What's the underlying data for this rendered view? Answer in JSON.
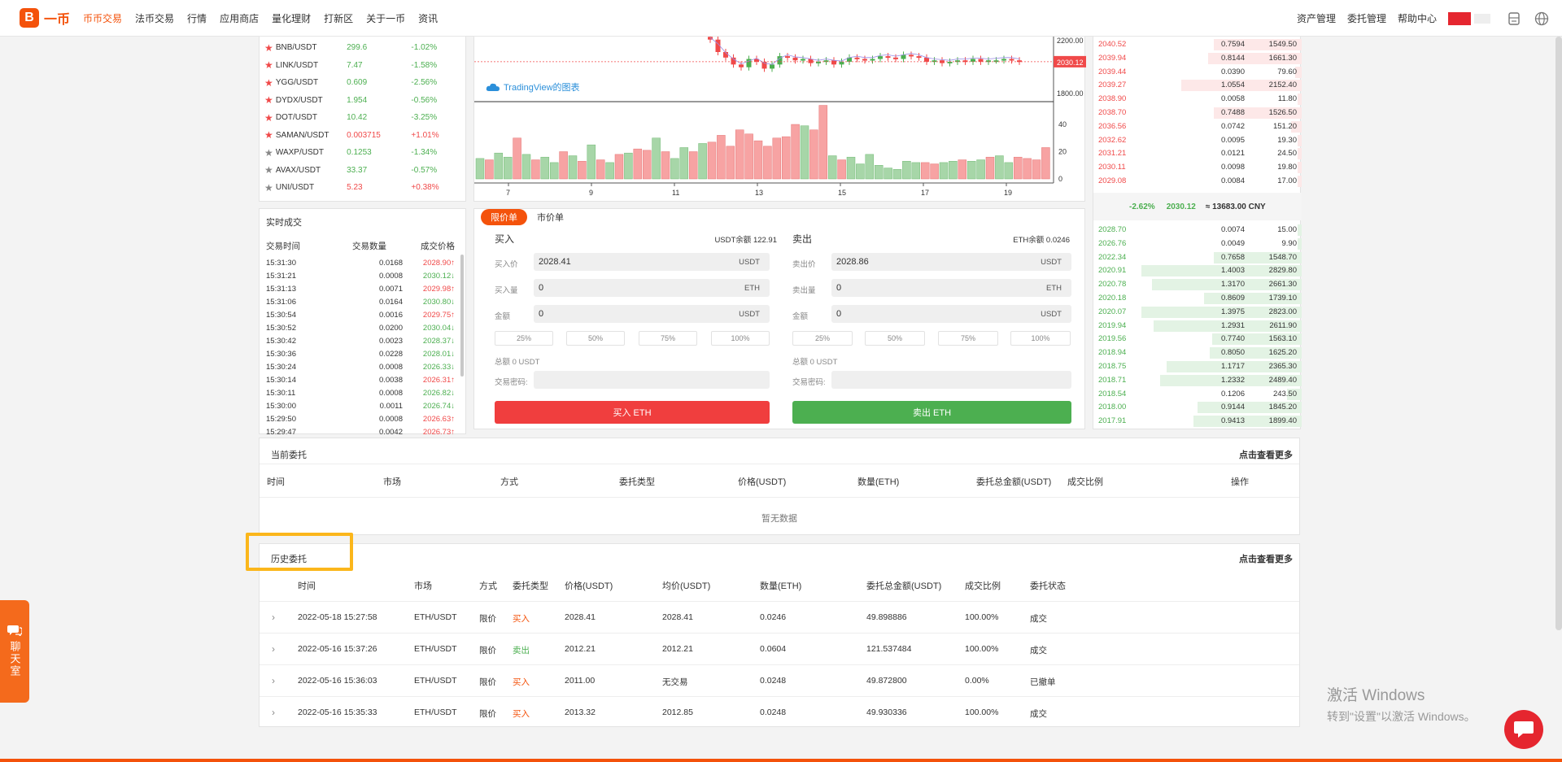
{
  "nav": {
    "logo_text": "一币",
    "items": [
      "币币交易",
      "法币交易",
      "行情",
      "应用商店",
      "量化理财",
      "打新区",
      "关于一币",
      "资讯"
    ],
    "active_index": 0,
    "right_items": [
      "资产管理",
      "委托管理",
      "帮助中心"
    ],
    "accent_color": "#f4520b"
  },
  "markets": [
    {
      "name": "BNB/USDT",
      "price": "299.6",
      "change": "-1.02%",
      "dir": "green",
      "starred": true
    },
    {
      "name": "LINK/USDT",
      "price": "7.47",
      "change": "-1.58%",
      "dir": "green",
      "starred": true
    },
    {
      "name": "YGG/USDT",
      "price": "0.609",
      "change": "-2.56%",
      "dir": "green",
      "starred": true
    },
    {
      "name": "DYDX/USDT",
      "price": "1.954",
      "change": "-0.56%",
      "dir": "green",
      "starred": true
    },
    {
      "name": "DOT/USDT",
      "price": "10.42",
      "change": "-3.25%",
      "dir": "green",
      "starred": true
    },
    {
      "name": "SAMAN/USDT",
      "price": "0.003715",
      "change": "+1.01%",
      "dir": "red",
      "starred": true
    },
    {
      "name": "WAXP/USDT",
      "price": "0.1253",
      "change": "-1.34%",
      "dir": "green",
      "starred": false
    },
    {
      "name": "AVAX/USDT",
      "price": "33.37",
      "change": "-0.57%",
      "dir": "green",
      "starred": false
    },
    {
      "name": "UNI/USDT",
      "price": "5.23",
      "change": "+0.38%",
      "dir": "red",
      "starred": false
    }
  ],
  "trades": {
    "title": "实时成交",
    "headers": [
      "交易时间",
      "交易数量",
      "成交价格"
    ],
    "rows": [
      {
        "time": "15:31:30",
        "qty": "0.0168",
        "price": "2028.90",
        "dir": "red",
        "arrow": "↑"
      },
      {
        "time": "15:31:21",
        "qty": "0.0008",
        "price": "2030.12",
        "dir": "green",
        "arrow": "↓"
      },
      {
        "time": "15:31:13",
        "qty": "0.0071",
        "price": "2029.98",
        "dir": "red",
        "arrow": "↑"
      },
      {
        "time": "15:31:06",
        "qty": "0.0164",
        "price": "2030.80",
        "dir": "green",
        "arrow": "↓"
      },
      {
        "time": "15:30:54",
        "qty": "0.0016",
        "price": "2029.75",
        "dir": "red",
        "arrow": "↑"
      },
      {
        "time": "15:30:52",
        "qty": "0.0200",
        "price": "2030.04",
        "dir": "green",
        "arrow": "↓"
      },
      {
        "time": "15:30:42",
        "qty": "0.0023",
        "price": "2028.37",
        "dir": "green",
        "arrow": "↓"
      },
      {
        "time": "15:30:36",
        "qty": "0.0228",
        "price": "2028.01",
        "dir": "green",
        "arrow": "↓"
      },
      {
        "time": "15:30:24",
        "qty": "0.0008",
        "price": "2026.33",
        "dir": "green",
        "arrow": "↓"
      },
      {
        "time": "15:30:14",
        "qty": "0.0038",
        "price": "2026.31",
        "dir": "red",
        "arrow": "↑"
      },
      {
        "time": "15:30:11",
        "qty": "0.0008",
        "price": "2026.82",
        "dir": "green",
        "arrow": "↓"
      },
      {
        "time": "15:30:00",
        "qty": "0.0011",
        "price": "2026.74",
        "dir": "green",
        "arrow": "↓"
      },
      {
        "time": "15:29:50",
        "qty": "0.0008",
        "price": "2026.63",
        "dir": "red",
        "arrow": "↑"
      },
      {
        "time": "15:29:47",
        "qty": "0.0042",
        "price": "2026.73",
        "dir": "red",
        "arrow": "↑"
      }
    ]
  },
  "chart": {
    "watermark": "TradingView的图表",
    "price_ticks": [
      "2200.00",
      "1800.00"
    ],
    "current_price": "2030.12",
    "volume_ticks": [
      "40",
      "20",
      "0"
    ],
    "x_ticks": [
      "7",
      "9",
      "11",
      "13",
      "15",
      "17",
      "19"
    ],
    "volumes_up": [
      true,
      false,
      true,
      true,
      false,
      true,
      false,
      true,
      true,
      false,
      true,
      false,
      true,
      false,
      true,
      false,
      true,
      false,
      false,
      true,
      false,
      true,
      true,
      false,
      true,
      false,
      false,
      false,
      false,
      false,
      false,
      false,
      false,
      false,
      false,
      true,
      false,
      false,
      true,
      false,
      true,
      true,
      true,
      true,
      true,
      true,
      true,
      true,
      false,
      false,
      true,
      true,
      false,
      true,
      true,
      false,
      true,
      true,
      false,
      false,
      false,
      false
    ],
    "volumes": [
      15,
      14,
      19,
      16,
      30,
      18,
      14,
      16,
      12,
      20,
      17,
      13,
      25,
      14,
      12,
      18,
      19,
      22,
      21,
      30,
      20,
      15,
      23,
      20,
      26,
      27,
      32,
      24,
      36,
      33,
      28,
      24,
      30,
      31,
      40,
      39,
      36,
      54,
      17,
      14,
      16,
      11,
      18,
      10,
      8,
      7,
      13,
      12,
      12,
      11,
      12,
      13,
      14,
      13,
      14,
      16,
      17,
      12,
      16,
      15,
      14,
      23
    ],
    "closes": [
      2190,
      2100,
      2060,
      2010,
      1990,
      2050,
      2030,
      1980,
      2010,
      2070,
      2060,
      2040,
      2050,
      2020,
      2030,
      2040,
      2010,
      2030,
      2060,
      2050,
      2040,
      2050,
      2070,
      2060,
      2050,
      2080,
      2070,
      2060,
      2030,
      2040,
      2020,
      2030,
      2040,
      2030,
      2050,
      2030,
      2040,
      2040,
      2050,
      2040,
      2030
    ]
  },
  "orderform": {
    "tabs": [
      "限价单",
      "市价单"
    ],
    "buy": {
      "title": "买入",
      "balance": "USDT余额 122.91",
      "price_label": "买入价",
      "price": "2028.41",
      "price_unit": "USDT",
      "amount_label": "买入量",
      "amount": "0",
      "amount_unit": "ETH",
      "total_label": "金额",
      "total": "0",
      "total_unit": "USDT",
      "pcts": [
        "25%",
        "50%",
        "75%",
        "100%"
      ],
      "sum": "总额 0 USDT",
      "pwd_label": "交易密码:",
      "button": "买入 ETH",
      "color": "#f03e3e"
    },
    "sell": {
      "title": "卖出",
      "balance": "ETH余额 0.0246",
      "price_label": "卖出价",
      "price": "2028.86",
      "price_unit": "USDT",
      "amount_label": "卖出量",
      "amount": "0",
      "amount_unit": "ETH",
      "total_label": "金额",
      "total": "0",
      "total_unit": "USDT",
      "pcts": [
        "25%",
        "50%",
        "75%",
        "100%"
      ],
      "sum": "总额 0 USDT",
      "pwd_label": "交易密码:",
      "button": "卖出 ETH",
      "color": "#4caf50"
    }
  },
  "orderbook": {
    "asks": [
      {
        "price": "2040.52",
        "qty": "0.7594",
        "total": "1549.50",
        "depth": 0.42
      },
      {
        "price": "2039.94",
        "qty": "0.8144",
        "total": "1661.30",
        "depth": 0.45
      },
      {
        "price": "2039.44",
        "qty": "0.0390",
        "total": "79.60",
        "depth": 0.03
      },
      {
        "price": "2039.27",
        "qty": "1.0554",
        "total": "2152.40",
        "depth": 0.58
      },
      {
        "price": "2038.90",
        "qty": "0.0058",
        "total": "11.80",
        "depth": 0.02
      },
      {
        "price": "2038.70",
        "qty": "0.7488",
        "total": "1526.50",
        "depth": 0.42
      },
      {
        "price": "2036.56",
        "qty": "0.0742",
        "total": "151.20",
        "depth": 0.05
      },
      {
        "price": "2032.62",
        "qty": "0.0095",
        "total": "19.30",
        "depth": 0.02
      },
      {
        "price": "2031.21",
        "qty": "0.0121",
        "total": "24.50",
        "depth": 0.02
      },
      {
        "price": "2030.11",
        "qty": "0.0098",
        "total": "19.80",
        "depth": 0.02
      },
      {
        "price": "2029.08",
        "qty": "0.0084",
        "total": "17.00",
        "depth": 0.02
      }
    ],
    "mid": {
      "change": "-2.62%",
      "price": "2030.12",
      "cny": "≈ 13683.00 CNY"
    },
    "bids": [
      {
        "price": "2028.70",
        "qty": "0.0074",
        "total": "15.00",
        "depth": 0.02
      },
      {
        "price": "2026.76",
        "qty": "0.0049",
        "total": "9.90",
        "depth": 0.02
      },
      {
        "price": "2022.34",
        "qty": "0.7658",
        "total": "1548.70",
        "depth": 0.42
      },
      {
        "price": "2020.91",
        "qty": "1.4003",
        "total": "2829.80",
        "depth": 0.77
      },
      {
        "price": "2020.78",
        "qty": "1.3170",
        "total": "2661.30",
        "depth": 0.72
      },
      {
        "price": "2020.18",
        "qty": "0.8609",
        "total": "1739.10",
        "depth": 0.47
      },
      {
        "price": "2020.07",
        "qty": "1.3975",
        "total": "2823.00",
        "depth": 0.77
      },
      {
        "price": "2019.94",
        "qty": "1.2931",
        "total": "2611.90",
        "depth": 0.71
      },
      {
        "price": "2019.56",
        "qty": "0.7740",
        "total": "1563.10",
        "depth": 0.43
      },
      {
        "price": "2018.94",
        "qty": "0.8050",
        "total": "1625.20",
        "depth": 0.44
      },
      {
        "price": "2018.75",
        "qty": "1.1717",
        "total": "2365.30",
        "depth": 0.65
      },
      {
        "price": "2018.71",
        "qty": "1.2332",
        "total": "2489.40",
        "depth": 0.68
      },
      {
        "price": "2018.54",
        "qty": "0.1206",
        "total": "243.50",
        "depth": 0.07
      },
      {
        "price": "2018.00",
        "qty": "0.9144",
        "total": "1845.20",
        "depth": 0.5
      },
      {
        "price": "2017.91",
        "qty": "0.9413",
        "total": "1899.40",
        "depth": 0.52
      }
    ]
  },
  "current_orders": {
    "title": "当前委托",
    "more": "点击查看更多",
    "headers": [
      "时间",
      "市场",
      "方式",
      "委托类型",
      "价格(USDT)",
      "数量(ETH)",
      "委托总金额(USDT)",
      "成交比例",
      "操作"
    ],
    "empty": "暂无数据"
  },
  "history_orders": {
    "title": "历史委托",
    "more": "点击查看更多",
    "headers": [
      "时间",
      "市场",
      "方式",
      "委托类型",
      "价格(USDT)",
      "均价(USDT)",
      "数量(ETH)",
      "委托总金额(USDT)",
      "成交比例",
      "委托状态"
    ],
    "rows": [
      {
        "time": "2022-05-18 15:27:58",
        "market": "ETH/USDT",
        "mode": "限价",
        "type": "买入",
        "dir": "buy",
        "price": "2028.41",
        "avg": "2028.41",
        "qty": "0.0246",
        "total": "49.898886",
        "ratio": "100.00%",
        "status": "成交"
      },
      {
        "time": "2022-05-16 15:37:26",
        "market": "ETH/USDT",
        "mode": "限价",
        "type": "卖出",
        "dir": "sell",
        "price": "2012.21",
        "avg": "2012.21",
        "qty": "0.0604",
        "total": "121.537484",
        "ratio": "100.00%",
        "status": "成交"
      },
      {
        "time": "2022-05-16 15:36:03",
        "market": "ETH/USDT",
        "mode": "限价",
        "type": "买入",
        "dir": "buy",
        "price": "2011.00",
        "avg": "无交易",
        "qty": "0.0248",
        "total": "49.872800",
        "ratio": "0.00%",
        "status": "已撤单"
      },
      {
        "time": "2022-05-16 15:35:33",
        "market": "ETH/USDT",
        "mode": "限价",
        "type": "买入",
        "dir": "buy",
        "price": "2013.32",
        "avg": "2012.85",
        "qty": "0.0248",
        "total": "49.930336",
        "ratio": "100.00%",
        "status": "成交"
      }
    ]
  },
  "chat_tab": "聊天室",
  "watermark": {
    "line1": "激活 Windows",
    "line2": "转到\"设置\"以激活 Windows。"
  }
}
